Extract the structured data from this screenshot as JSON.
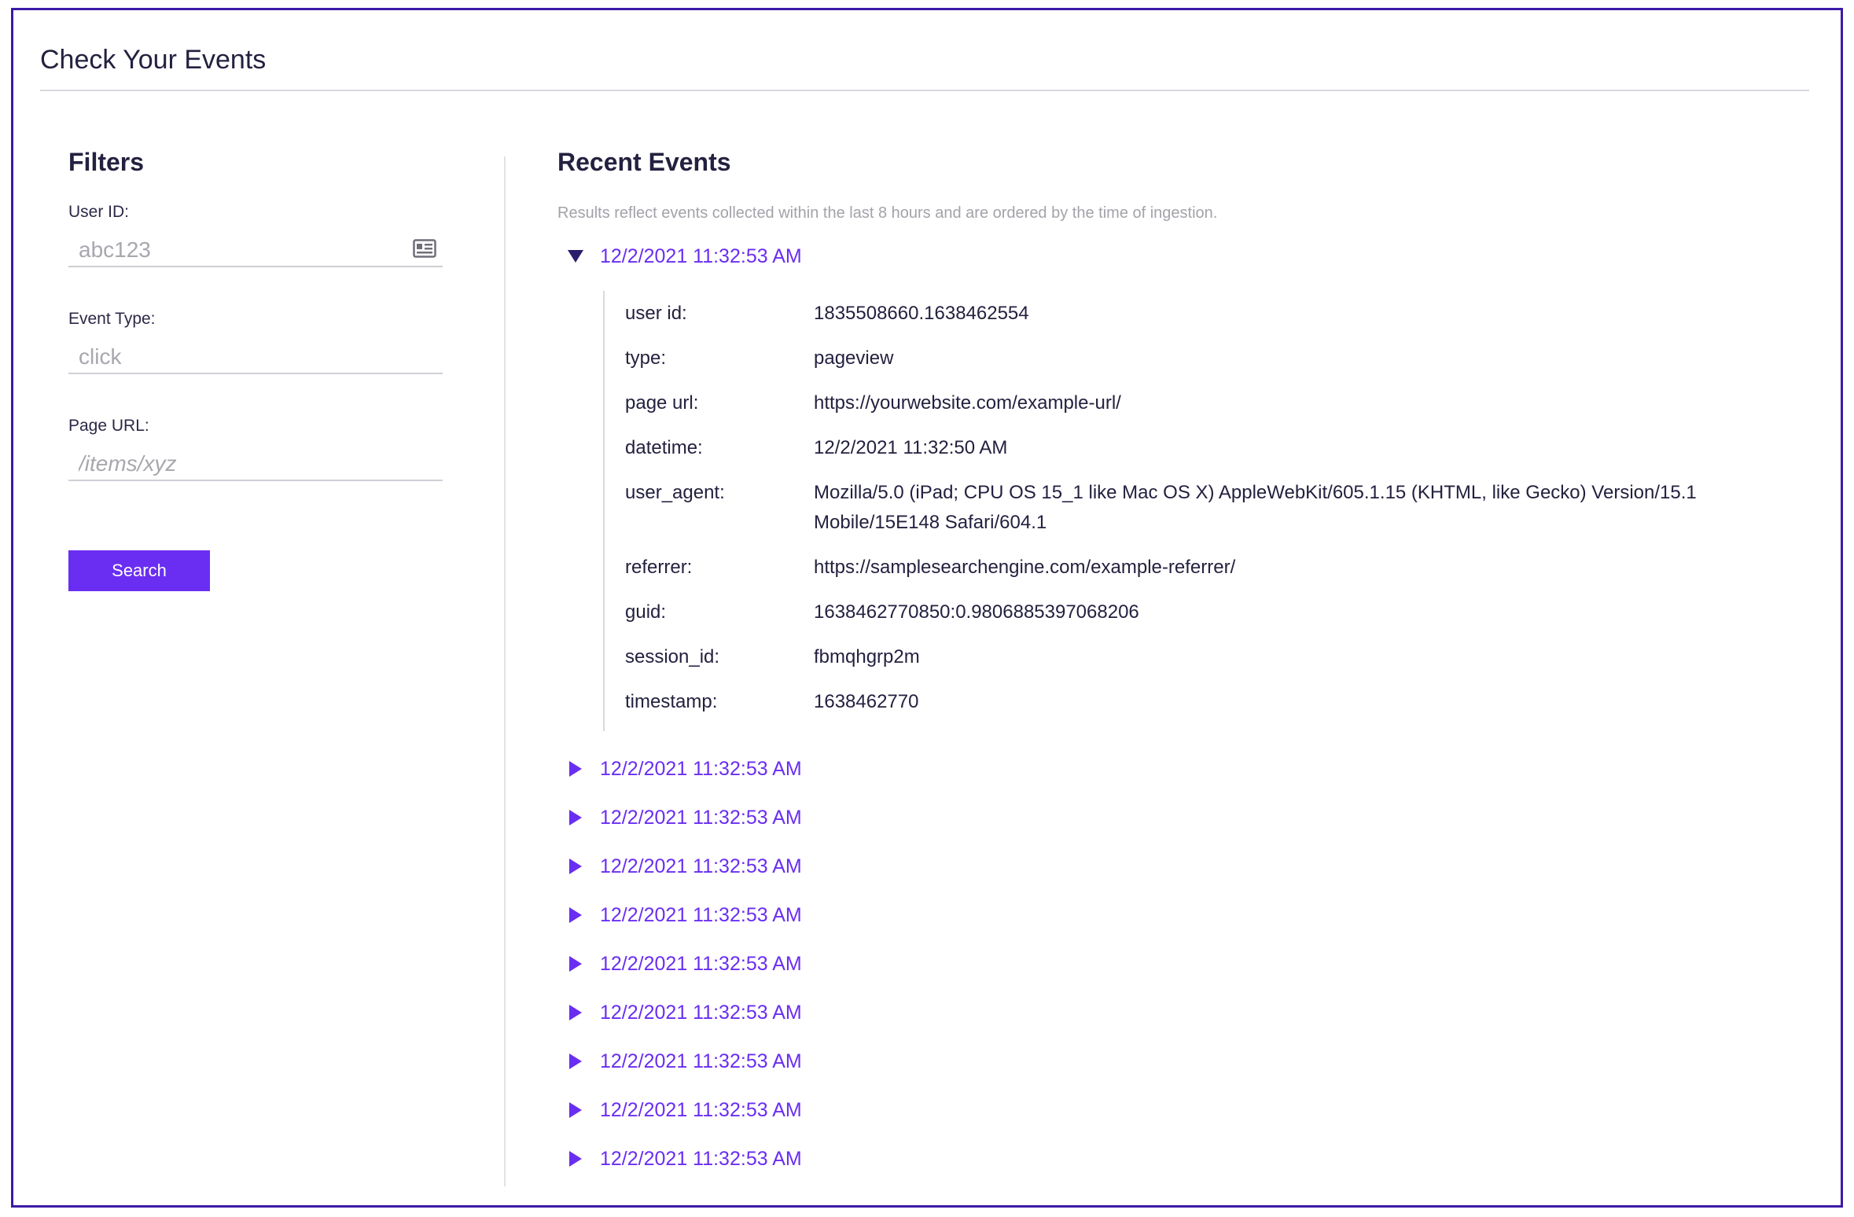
{
  "page": {
    "title": "Check Your Events"
  },
  "filters": {
    "title": "Filters",
    "user_id": {
      "label": "User ID:",
      "placeholder": "abc123",
      "icon": "contact-card-icon"
    },
    "event_type": {
      "label": "Event Type:",
      "placeholder": "click"
    },
    "page_url": {
      "label": "Page URL:",
      "placeholder": "/items/xyz"
    },
    "search_label": "Search"
  },
  "events": {
    "title": "Recent Events",
    "subtitle": "Results reflect events collected within the last 8 hours and are ordered by the time of ingestion.",
    "expanded": {
      "time": "12/2/2021 11:32:53 AM",
      "fields": [
        {
          "key": "user id:",
          "value": "1835508660.1638462554"
        },
        {
          "key": "type:",
          "value": "pageview"
        },
        {
          "key": "page url:",
          "value": "https://yourwebsite.com/example-url/"
        },
        {
          "key": "datetime:",
          "value": "12/2/2021 11:32:50 AM"
        },
        {
          "key": "user_agent:",
          "value": "Mozilla/5.0 (iPad; CPU OS 15_1 like Mac OS X) AppleWebKit/605.1.15 (KHTML, like Gecko) Version/15.1 Mobile/15E148 Safari/604.1"
        },
        {
          "key": "referrer:",
          "value": "https://samplesearchengine.com/example-referrer/"
        },
        {
          "key": "guid:",
          "value": "1638462770850:0.9806885397068206"
        },
        {
          "key": "session_id:",
          "value": "fbmqhgrp2m"
        },
        {
          "key": "timestamp:",
          "value": "1638462770"
        }
      ]
    },
    "collapsed": [
      {
        "time": "12/2/2021 11:32:53 AM"
      },
      {
        "time": "12/2/2021 11:32:53 AM"
      },
      {
        "time": "12/2/2021 11:32:53 AM"
      },
      {
        "time": "12/2/2021 11:32:53 AM"
      },
      {
        "time": "12/2/2021 11:32:53 AM"
      },
      {
        "time": "12/2/2021 11:32:53 AM"
      },
      {
        "time": "12/2/2021 11:32:53 AM"
      },
      {
        "time": "12/2/2021 11:32:53 AM"
      },
      {
        "time": "12/2/2021 11:32:53 AM"
      }
    ]
  },
  "colors": {
    "accent": "#6a2ef2",
    "frame": "#3b1aa8",
    "text": "#23213f",
    "muted": "#a2a2aa"
  }
}
